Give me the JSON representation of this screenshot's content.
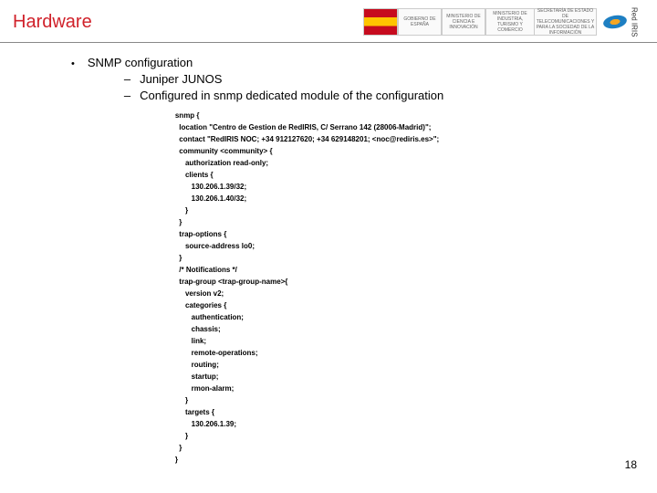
{
  "header": {
    "title": "Hardware",
    "logos": {
      "gov": "GOBIERNO DE ESPAÑA",
      "min1": "MINISTERIO DE CIENCIA E INNOVACIÓN",
      "min2": "MINISTERIO DE INDUSTRIA, TURISMO Y COMERCIO",
      "sec": "SECRETARÍA DE ESTADO DE TELECOMUNICACIONES Y PARA LA SOCIEDAD DE LA INFORMACIÓN",
      "iris": "Red IRIS"
    }
  },
  "content": {
    "bullet_label": "SNMP configuration",
    "sub1": "Juniper JUNOS",
    "sub2": "Configured in snmp dedicated module of the configuration",
    "code": "snmp {\n  location \"Centro de Gestion de RedIRIS, C/ Serrano 142 (28006-Madrid)\";\n  contact \"RedIRIS NOC; +34 912127620; +34 629148201; <noc@rediris.es>\";\n  community <community> {\n     authorization read-only;\n     clients {\n        130.206.1.39/32;\n        130.206.1.40/32;\n     }\n  }\n  trap-options {\n     source-address lo0;\n  }\n  /* Notifications */\n  trap-group <trap-group-name>{\n     version v2;\n     categories {\n        authentication;\n        chassis;\n        link;\n        remote-operations;\n        routing;\n        startup;\n        rmon-alarm;\n     }\n     targets {\n        130.206.1.39;\n     }\n  }\n}"
  },
  "page_number": "18"
}
